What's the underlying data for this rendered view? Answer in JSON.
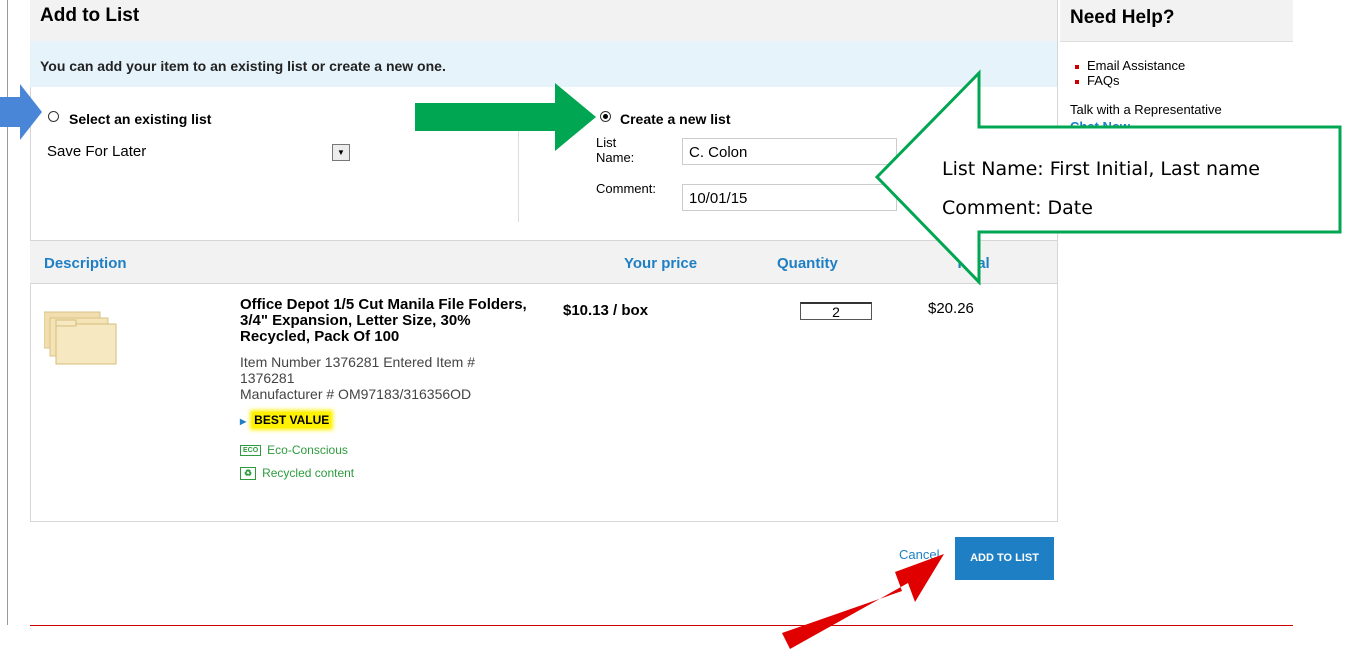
{
  "dialog": {
    "title": "Add to List",
    "info": "You can add your item to an existing list or create a new one."
  },
  "existing": {
    "label": "Select an existing list",
    "selected": "Save For Later"
  },
  "new_list": {
    "label": "Create a new list",
    "name_label_1": "List",
    "name_label_2": "Name:",
    "name_value": "C. Colon",
    "comment_label": "Comment:",
    "comment_value": "10/01/15"
  },
  "table": {
    "headers": [
      "Description",
      "Your price",
      "Quantity",
      "Total"
    ]
  },
  "product": {
    "name": "Office Depot 1/5 Cut Manila File Folders, 3/4\" Expansion, Letter Size, 30% Recycled, Pack Of 100",
    "item_line_1": "Item Number 1376281 Entered Item #",
    "item_line_2": "1376281",
    "manufacturer": "Manufacturer #  OM97183/316356OD",
    "badge": "BEST VALUE",
    "eco_icon_text": "ECO",
    "eco": "Eco-Conscious",
    "recycled": "Recycled content",
    "price": "$10.13 / box",
    "quantity": "2",
    "total": "$20.26"
  },
  "actions": {
    "cancel": "Cancel",
    "add": "ADD TO LIST"
  },
  "help": {
    "title": "Need Help?",
    "items": [
      "Email Assistance",
      "FAQs"
    ],
    "talk": "Talk with a Representative",
    "chat": "Chat Now"
  },
  "annotation": {
    "line1": "List Name: First Initial, Last name",
    "line2": "Comment: Date"
  },
  "colors": {
    "accent": "#1f7fc4",
    "arrow_blue": "#4a86d8",
    "arrow_green": "#00a651",
    "arrow_red": "#e00000"
  }
}
